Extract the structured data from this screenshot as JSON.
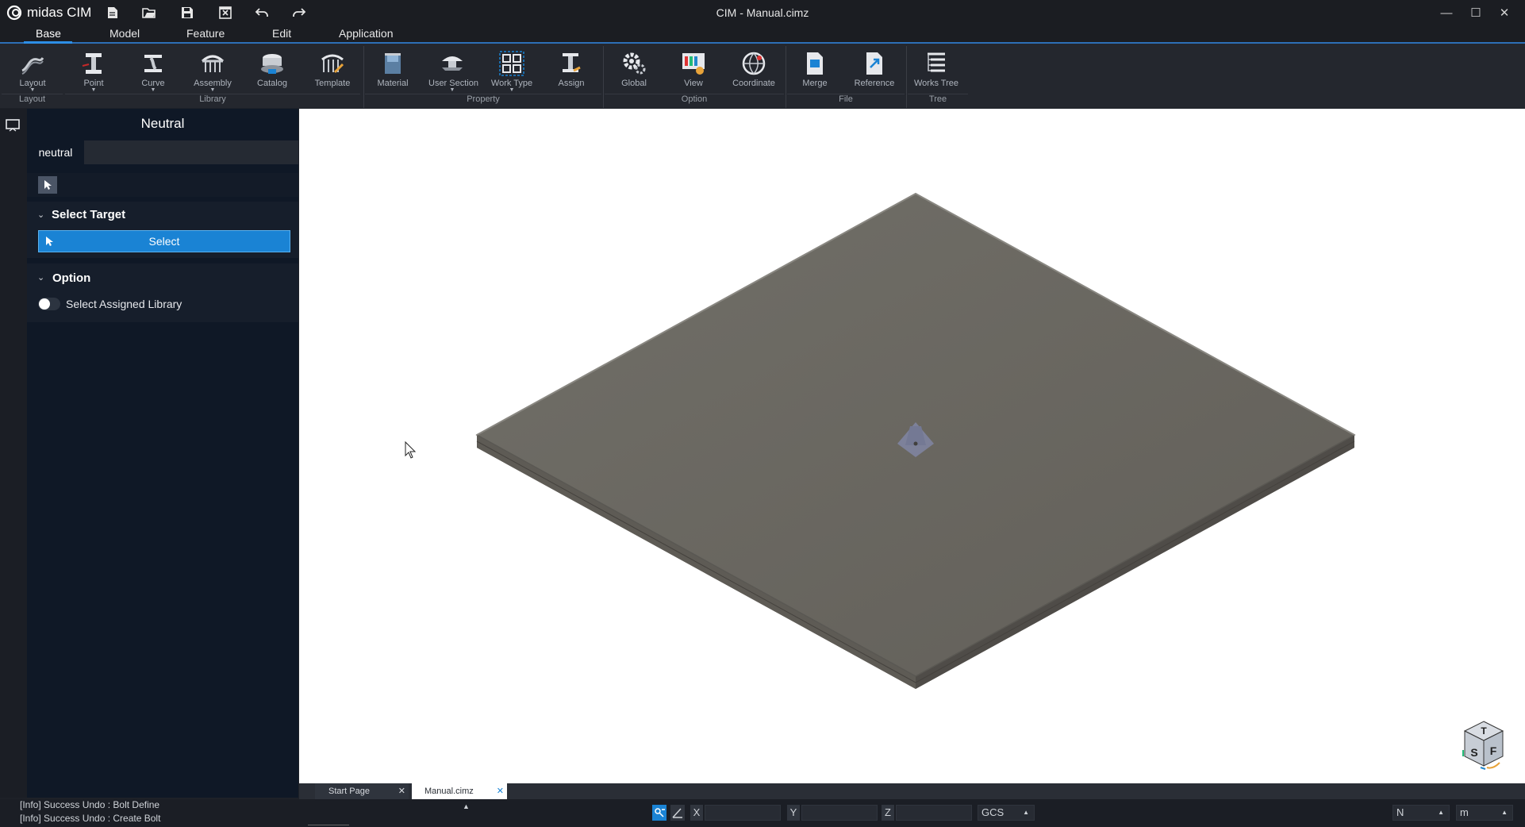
{
  "app": {
    "brand": "midas CIM",
    "window_title": "CIM - Manual.cimz"
  },
  "menu": {
    "tabs": [
      "Base",
      "Model",
      "Feature",
      "Edit",
      "Application"
    ],
    "active": "Base"
  },
  "ribbon": {
    "buttons": [
      "Layout",
      "Point",
      "Curve",
      "Assembly",
      "Catalog",
      "Template",
      "Material",
      "User Section",
      "Work Type",
      "Assign",
      "Global",
      "View",
      "Coordinate",
      "Merge",
      "Reference",
      "Works Tree"
    ],
    "groups": [
      "Layout",
      "Library",
      "Property",
      "Option",
      "File",
      "Tree"
    ]
  },
  "panel": {
    "title": "Neutral",
    "tab": "neutral",
    "select_target": {
      "header": "Select Target",
      "button": "Select"
    },
    "option": {
      "header": "Option",
      "toggle_label": "Select Assigned Library",
      "toggle_on": false
    }
  },
  "doc_tabs": [
    "Start Page",
    "Manual.cimz"
  ],
  "active_doc_tab": "Manual.cimz",
  "output": {
    "lines": [
      "[Info] Success Undo : Bolt Define",
      "[Info] Success Undo : Create Bolt"
    ]
  },
  "coords": {
    "x_label": "X",
    "y_label": "Y",
    "z_label": "Z",
    "system": "GCS",
    "force_unit": "N",
    "length_unit": "m"
  },
  "view_cube": {
    "faces": [
      "T",
      "S",
      "F"
    ]
  },
  "colors": {
    "accent": "#1a83d4",
    "panel_bg": "#0f1826",
    "slab": "#6b6963"
  }
}
